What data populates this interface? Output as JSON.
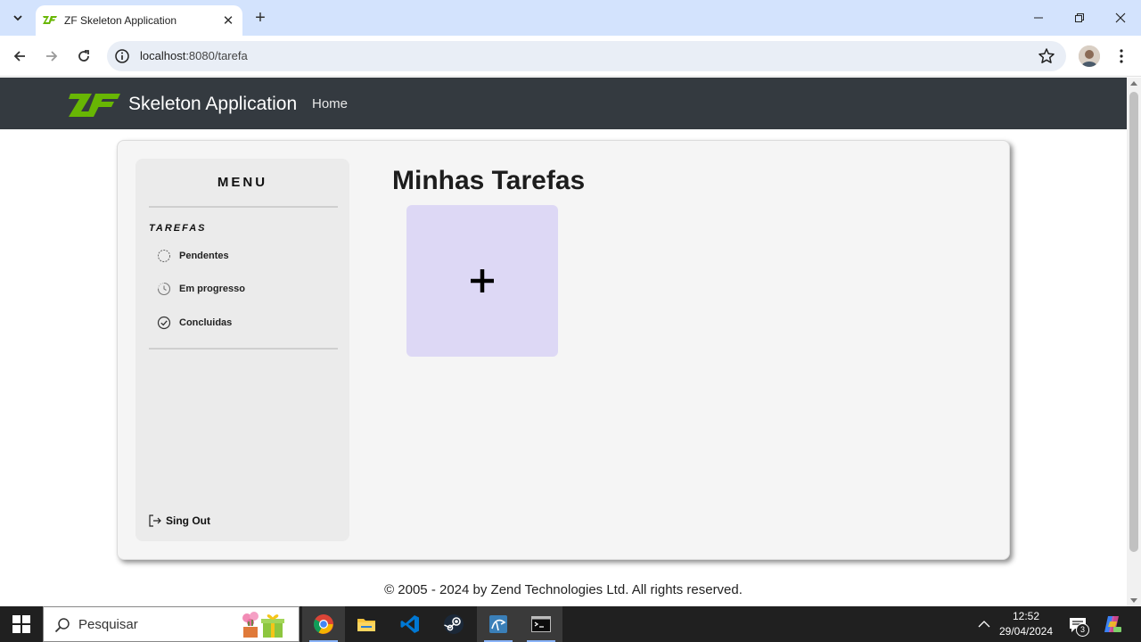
{
  "browser": {
    "tab_title": "ZF Skeleton Application",
    "url_host": "localhost",
    "url_rest": ":8080/tarefa",
    "tab_close_icon": "close-icon",
    "new_tab_icon": "plus-icon"
  },
  "navbar": {
    "brand": "Skeleton Application",
    "home_link": "Home",
    "bg_color": "#343a40"
  },
  "sidebar": {
    "menu_title": "MENU",
    "section_label": "TAREFAS",
    "items": [
      {
        "label": "Pendentes",
        "icon": "circle-dashed-icon"
      },
      {
        "label": "Em progresso",
        "icon": "clock-progress-icon"
      },
      {
        "label": "Concluidas",
        "icon": "check-circle-icon"
      }
    ],
    "signout_label": "Sing Out",
    "signout_icon": "logout-icon"
  },
  "main": {
    "title": "Minhas Tarefas",
    "add_tile_icon": "plus-icon",
    "add_tile_color": "#ddd8f5"
  },
  "footer": {
    "text": "© 2005 - 2024 by Zend Technologies Ltd. All rights reserved."
  },
  "taskbar": {
    "search_placeholder": "Pesquisar",
    "time": "12:52",
    "date": "29/04/2024",
    "notification_count": "3",
    "apps": [
      "chrome-icon",
      "file-explorer-icon",
      "vscode-icon",
      "steam-icon",
      "mysql-workbench-icon",
      "terminal-icon"
    ]
  }
}
